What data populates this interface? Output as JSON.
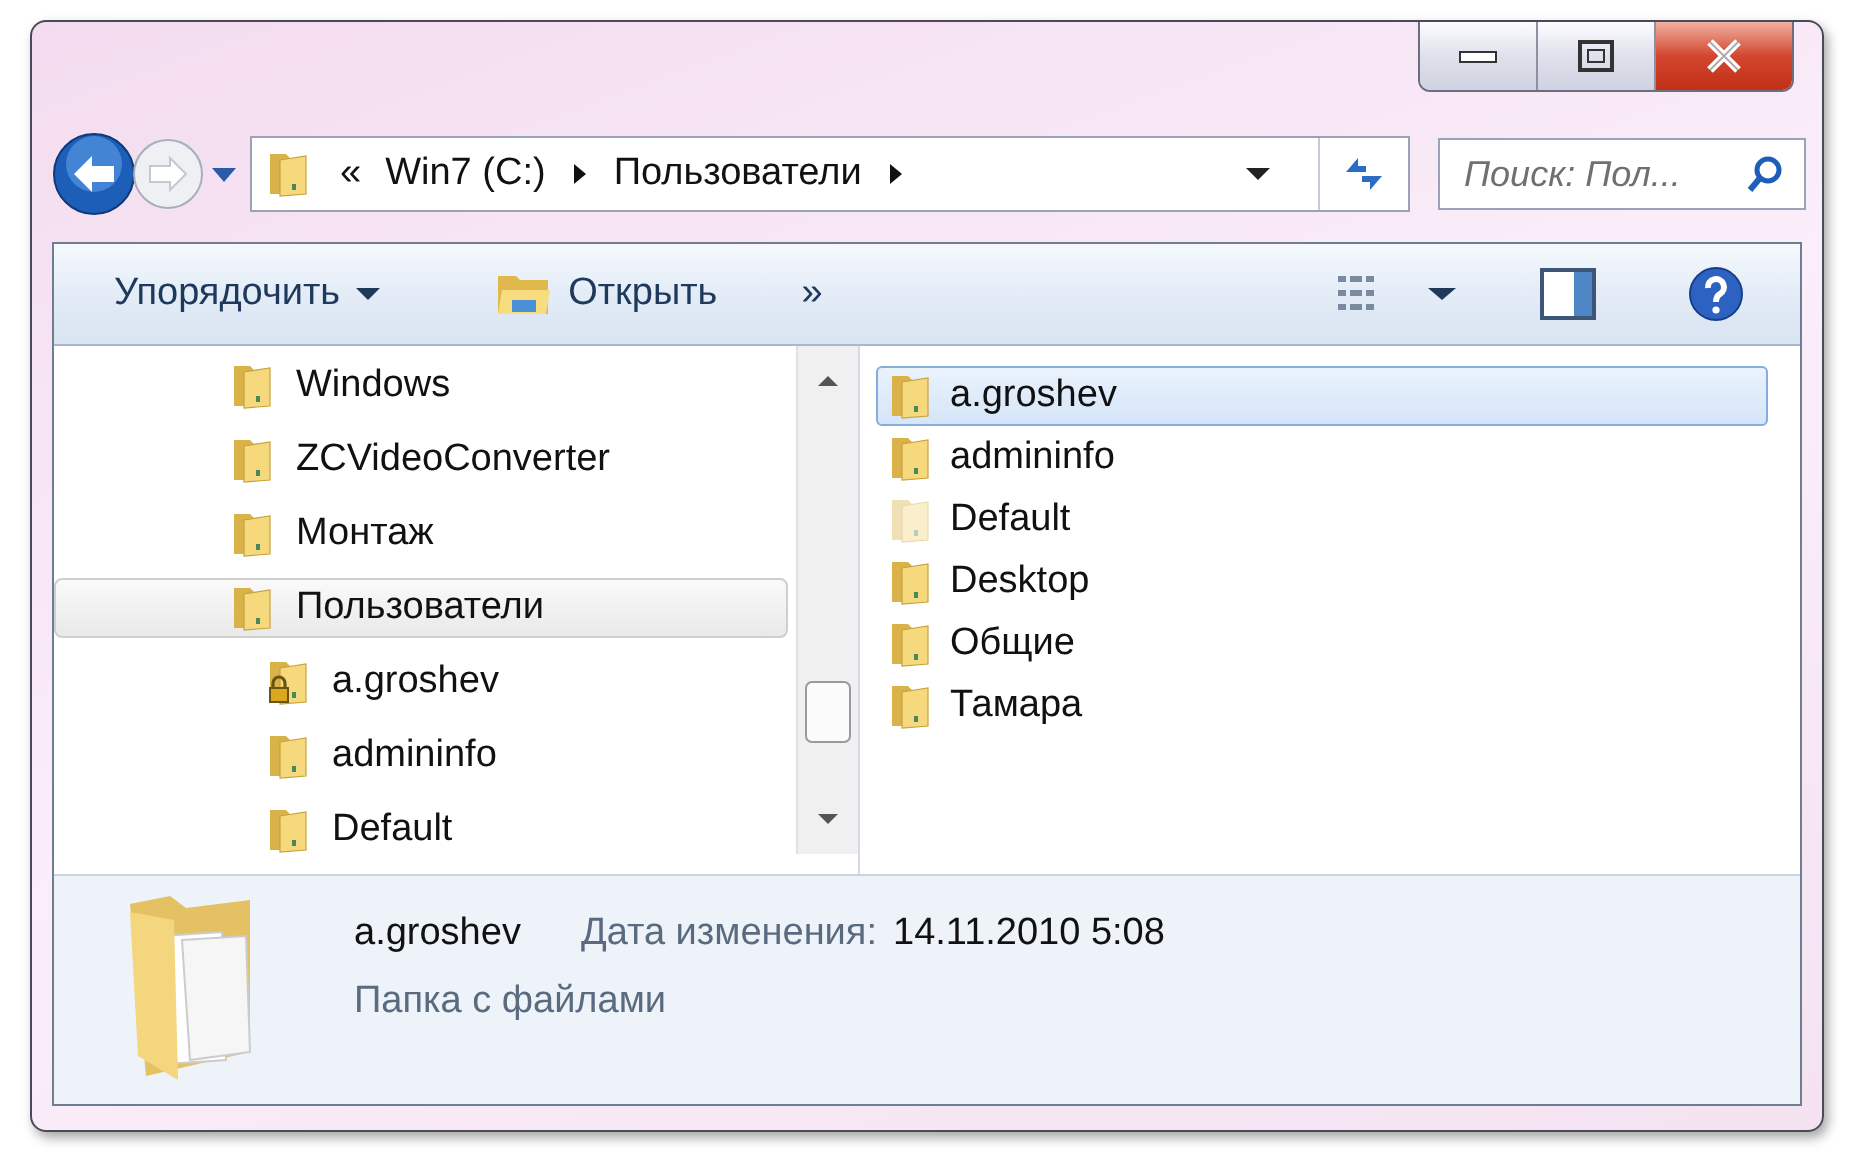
{
  "address": {
    "overflow": "«",
    "crumbs": [
      "Win7 (C:)",
      "Пользователи"
    ]
  },
  "search": {
    "placeholder": "Поиск: Пол..."
  },
  "toolbar": {
    "organize": "Упорядочить",
    "open": "Открыть",
    "more": "»"
  },
  "tree": {
    "items": [
      {
        "label": "Windows",
        "selected": false,
        "locked": false
      },
      {
        "label": "ZCVideoConverter",
        "selected": false,
        "locked": false
      },
      {
        "label": "Монтаж",
        "selected": false,
        "locked": false
      },
      {
        "label": "Пользователи",
        "selected": true,
        "locked": false,
        "children": [
          {
            "label": "a.groshev",
            "selected": false,
            "locked": true
          },
          {
            "label": "admininfo",
            "selected": false,
            "locked": false
          },
          {
            "label": "Default",
            "selected": false,
            "locked": false
          }
        ]
      }
    ]
  },
  "files": [
    {
      "name": "a.groshev",
      "selected": true,
      "hidden": false
    },
    {
      "name": "admininfo",
      "selected": false,
      "hidden": false
    },
    {
      "name": "Default",
      "selected": false,
      "hidden": true
    },
    {
      "name": "Desktop",
      "selected": false,
      "hidden": false
    },
    {
      "name": "Общие",
      "selected": false,
      "hidden": false
    },
    {
      "name": "Тамара",
      "selected": false,
      "hidden": false
    }
  ],
  "details": {
    "name": "a.groshev",
    "date_label": "Дата изменения:",
    "date_value": "14.11.2010 5:08",
    "type": "Папка с файлами"
  }
}
